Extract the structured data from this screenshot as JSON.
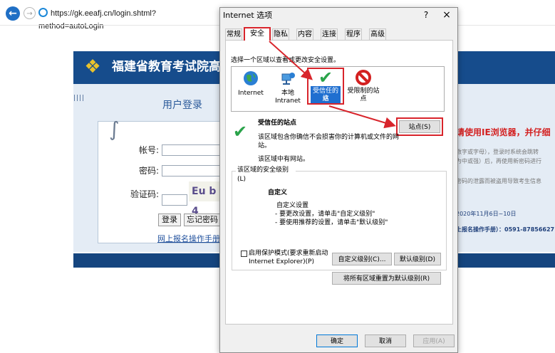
{
  "browser": {
    "url": "https://gk.eeafj.cn/login.shtml?method=autoLogin"
  },
  "web_page": {
    "site_title": "福建省教育考试院高考",
    "login_title": "用户登录",
    "account_label": "帐号:",
    "password_label": "密码:",
    "captcha_label": "验证码:",
    "captcha_text": "Eu b 4",
    "login_button": "登录",
    "forgot_button": "忘记密码",
    "register_link": "网上报名操作手册",
    "right_texts": [
      "请使用IE浏览器，并仔细",
      "数字或字母），登录时系统会跳转",
      "为中或强）后，再使用新密码进行",
      "密码的泄露而被盗用导致考生信息",
      "2020年11月6日~10日",
      "上报名操作手册）：0591-87856627"
    ]
  },
  "dialog": {
    "title": "Internet 选项",
    "help": "?",
    "close": "×",
    "tabs": [
      "常规",
      "安全",
      "隐私",
      "内容",
      "连接",
      "程序",
      "高级"
    ],
    "active_tab": "安全",
    "zone_prompt": "选择一个区域以查看或更改安全设置。",
    "zones": [
      {
        "icon": "globe-icon",
        "label_lines": [
          "Internet"
        ]
      },
      {
        "icon": "local-intranet-icon",
        "label_lines": [
          "本地",
          "Intranet"
        ]
      },
      {
        "icon": "check-icon",
        "label_lines": [
          "受信任的站",
          "点"
        ]
      },
      {
        "icon": "no-entry-icon",
        "label_lines": [
          "受限制的站",
          "点"
        ]
      }
    ],
    "selected_zone_title": "受信任的站点",
    "sites_button": "站点(S)",
    "zone_description_lines": [
      "该区域包含你确信不会损害你的计算机或文件的网",
      "站。"
    ],
    "zone_has_sites": "该区域中有网站。",
    "security_level_legend": "该区域的安全级别(L)",
    "level_title": "自定义",
    "level_lines": [
      "自定义设置",
      "- 要更改设置，请单击\"自定义级别\"",
      "- 要使用推荐的设置，请单击\"默认级别\""
    ],
    "protected_mode_lines": [
      "启用保护模式(要求重新启动",
      "Internet Explorer)(P)"
    ],
    "custom_level_button": "自定义级别(C)...",
    "default_level_button": "默认级别(D)",
    "reset_all_button": "将所有区域重置为默认级别(R)",
    "ok_button": "确定",
    "cancel_button": "取消",
    "apply_button": "应用(A)"
  },
  "colors": {
    "highlight_red": "#d8242b",
    "select_blue": "#1f6fd0",
    "header_blue": "#164c8c",
    "check_green": "#2aa34a"
  }
}
